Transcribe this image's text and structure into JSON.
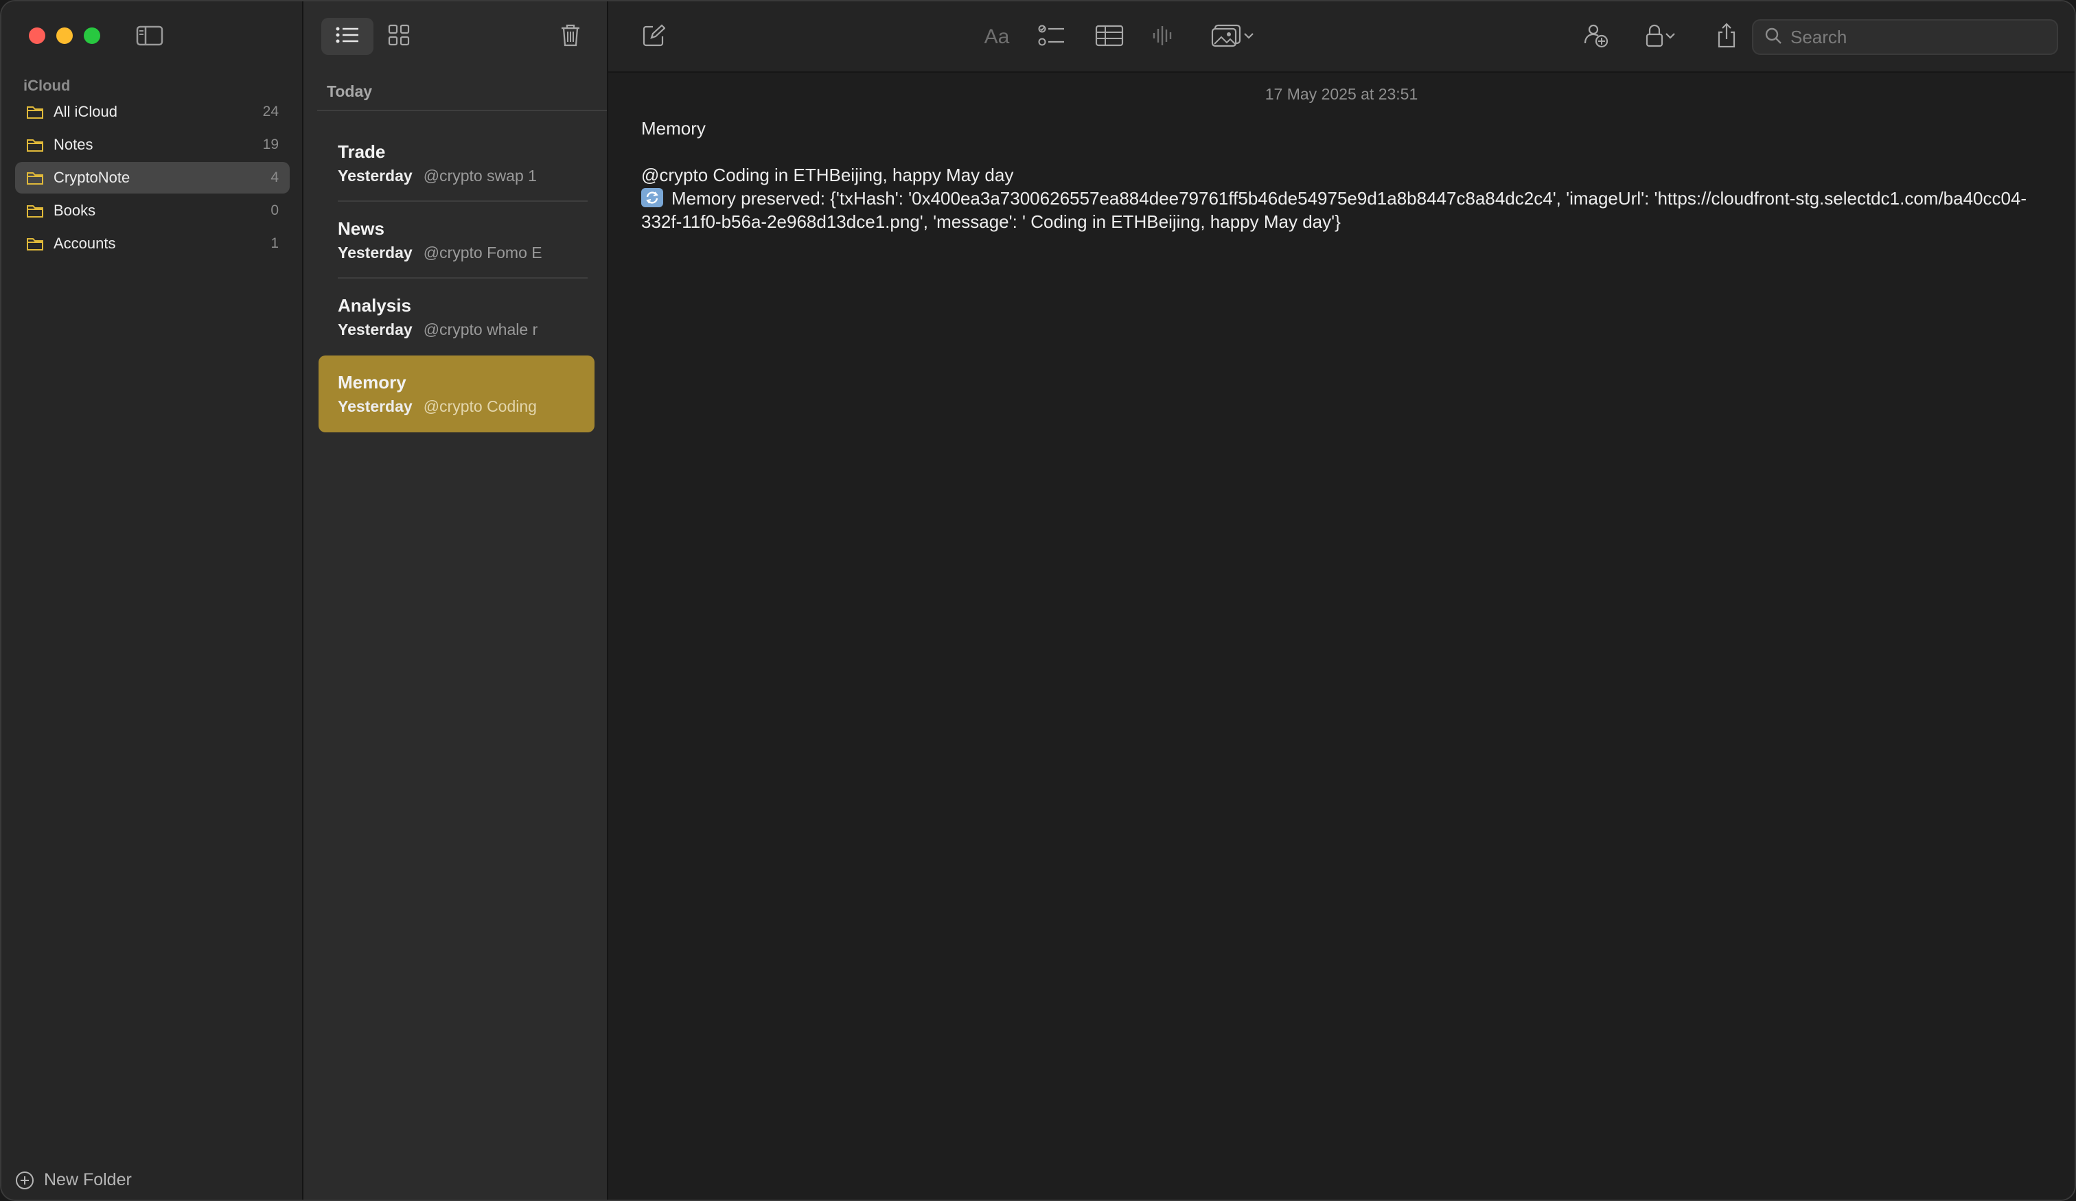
{
  "sidebar": {
    "section_label": "iCloud",
    "folders": [
      {
        "name": "All iCloud",
        "count": "24"
      },
      {
        "name": "Notes",
        "count": "19"
      },
      {
        "name": "CryptoNote",
        "count": "4"
      },
      {
        "name": "Books",
        "count": "0"
      },
      {
        "name": "Accounts",
        "count": "1"
      }
    ],
    "new_folder_label": "New Folder"
  },
  "notelist": {
    "group_label": "Today",
    "notes": [
      {
        "title": "Trade",
        "date": "Yesterday",
        "snippet": "@crypto swap 1"
      },
      {
        "title": "News",
        "date": "Yesterday",
        "snippet": "@crypto Fomo E"
      },
      {
        "title": "Analysis",
        "date": "Yesterday",
        "snippet": "@crypto whale r"
      },
      {
        "title": "Memory",
        "date": "Yesterday",
        "snippet": "@crypto Coding"
      }
    ]
  },
  "editor": {
    "search_placeholder": "Search",
    "format_label": "Aa",
    "timestamp": "17 May 2025 at 23:51",
    "heading": "Memory",
    "line1": "@crypto Coding in ETHBeijing, happy May day",
    "line2": "Memory preserved: {'txHash': '0x400ea3a7300626557ea884dee79761ff5b46de54975e9d1a8b8447c8a84dc2c4', 'imageUrl': 'https://cloudfront-stg.selectdc1.com/ba40cc04-332f-11f0-b56a-2e968d13dce1.png', 'message': ' Coding in ETHBeijing, happy May day'}"
  },
  "colors": {
    "selected_note": "#a4872f",
    "folder_icon": "#e0b93a",
    "close": "#ff5f57",
    "minimize": "#febc2e",
    "maximize": "#28c840"
  }
}
